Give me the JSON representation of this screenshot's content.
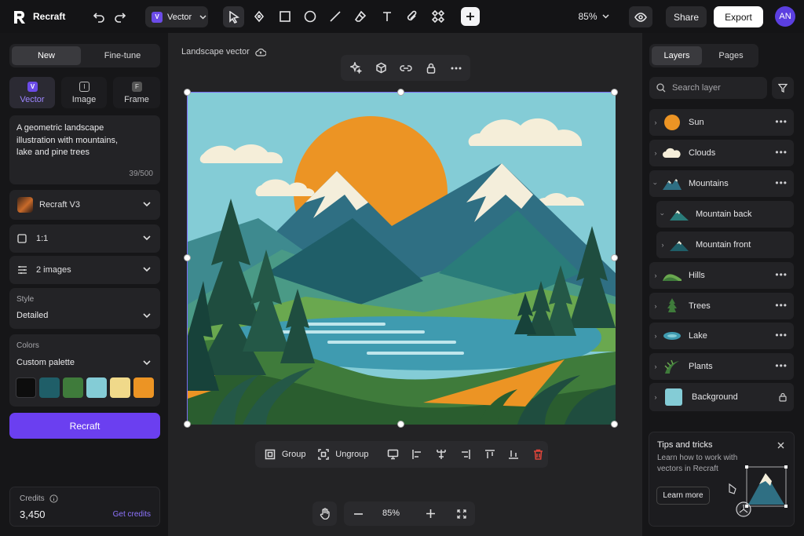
{
  "app": {
    "name": "Recraft"
  },
  "topbar": {
    "mode_label": "Vector",
    "mode_badge": "V",
    "zoom": "85%",
    "share_label": "Share",
    "export_label": "Export",
    "avatar_initials": "AN"
  },
  "left": {
    "tabs": [
      "New",
      "Fine-tune"
    ],
    "types": [
      {
        "label": "Vector",
        "badge": "V"
      },
      {
        "label": "Image",
        "badge": "I"
      },
      {
        "label": "Frame",
        "badge": "F"
      }
    ],
    "prompt": "A geometric landscape illustration with mountains, lake and pine trees",
    "prompt_count": "39/500",
    "model": "Recraft V3",
    "ratio": "1:1",
    "images": "2 images",
    "style_label": "Style",
    "style_value": "Detailed",
    "colors_label": "Colors",
    "colors_value": "Custom palette",
    "palette": [
      "#0d0d0d",
      "#1f5e68",
      "#3f7b3b",
      "#84ccd6",
      "#f0d98a",
      "#ec9424"
    ],
    "generate_label": "Recraft",
    "credits_label": "Credits",
    "credits_value": "3,450",
    "get_credits": "Get credits"
  },
  "canvas": {
    "title": "Landscape vector",
    "bottom_tools": {
      "group": "Group",
      "ungroup": "Ungroup"
    },
    "zoom": "85%"
  },
  "right": {
    "tabs": [
      "Layers",
      "Pages"
    ],
    "search_placeholder": "Search layer",
    "layers": [
      {
        "name": "Sun",
        "icon": "sun-icon"
      },
      {
        "name": "Clouds",
        "icon": "cloud-icon"
      },
      {
        "name": "Mountains",
        "icon": "mountains-icon"
      },
      {
        "name": "Mountain back",
        "icon": "mountain-icon"
      },
      {
        "name": "Mountain front",
        "icon": "mountain-icon"
      },
      {
        "name": "Hills",
        "icon": "hills-icon"
      },
      {
        "name": "Trees",
        "icon": "tree-icon"
      },
      {
        "name": "Lake",
        "icon": "lake-icon"
      },
      {
        "name": "Plants",
        "icon": "plant-icon"
      },
      {
        "name": "Background",
        "icon": "background-icon"
      }
    ],
    "tips": {
      "title": "Tips and tricks",
      "body": "Learn how to work with vectors in Recraft",
      "cta": "Learn more"
    }
  },
  "colors": {
    "accent": "#6b3ff0",
    "selection": "#7b6cf0",
    "delete": "#e0453a"
  }
}
